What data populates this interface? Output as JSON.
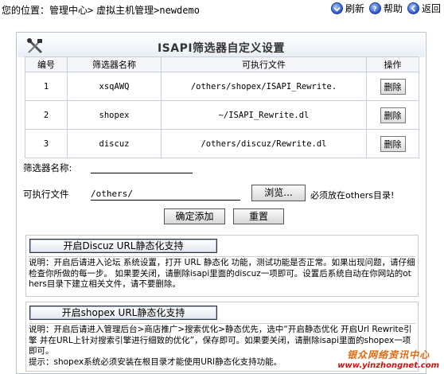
{
  "breadcrumb": {
    "prefix": "您的位置：",
    "items": [
      "管理中心",
      "虚拟主机管理",
      "newdemo"
    ],
    "separator": ">"
  },
  "toplinks": {
    "refresh": "刷新",
    "help": "帮助",
    "back": "返回"
  },
  "page": {
    "title": "ISAPI筛选器自定义设置"
  },
  "table": {
    "headers": [
      "编号",
      "筛选器名称",
      "可执行文件",
      "操作"
    ],
    "rows": [
      {
        "no": "1",
        "name": "xsqAWQ",
        "file": "/others/shopex/ISAPI_Rewrite.",
        "action": "删除"
      },
      {
        "no": "2",
        "name": "shopex",
        "file": "~/ISAPI_Rewrite.dl",
        "action": "删除"
      },
      {
        "no": "3",
        "name": "discuz",
        "file": "/others/discuz/Rewrite.dl",
        "action": "删除"
      }
    ]
  },
  "form": {
    "name_label": "筛选器名称:",
    "name_value": "",
    "file_label": "可执行文件",
    "file_value": "/others/",
    "browse_label": "浏览...",
    "note": "必须放在others目录!",
    "submit_label": "确定添加",
    "reset_label": "重置"
  },
  "discuz": {
    "button": "开启Discuz URL静态化支持",
    "desc": "说明：开启后请进入论坛 系统设置，打开 URL 静态化 功能，测试功能是否正常。如果出现问题，请仔细检查你所做的每一步。 如果要关闭，请删除isapi里面的discuz一项即可。设置后系统自动在你网站的others目录下建立相关文件，请不要删除。"
  },
  "shopex": {
    "button": "开启shopex URL静态化支持",
    "desc": "说明：开启后请进入管理后台>商店推广>搜索优化>静态优先，选中“开启静态优化 开启Url Rewrite引擎 并在URL上针对搜索引擎进行细致的优化”，保存即可。如果要关闭，请删除isapi里面的shopex一项即可。",
    "tip": "提示：shopex系统必须安装在根目录才能使用URl静态化支持功能。"
  },
  "logo": {
    "line1": "银众网络资讯中心",
    "line2": "www.yinzhongnet.com"
  },
  "icons": {
    "refresh": "refresh-icon",
    "help": "help-icon",
    "back": "back-icon",
    "title": "tools-icon"
  }
}
